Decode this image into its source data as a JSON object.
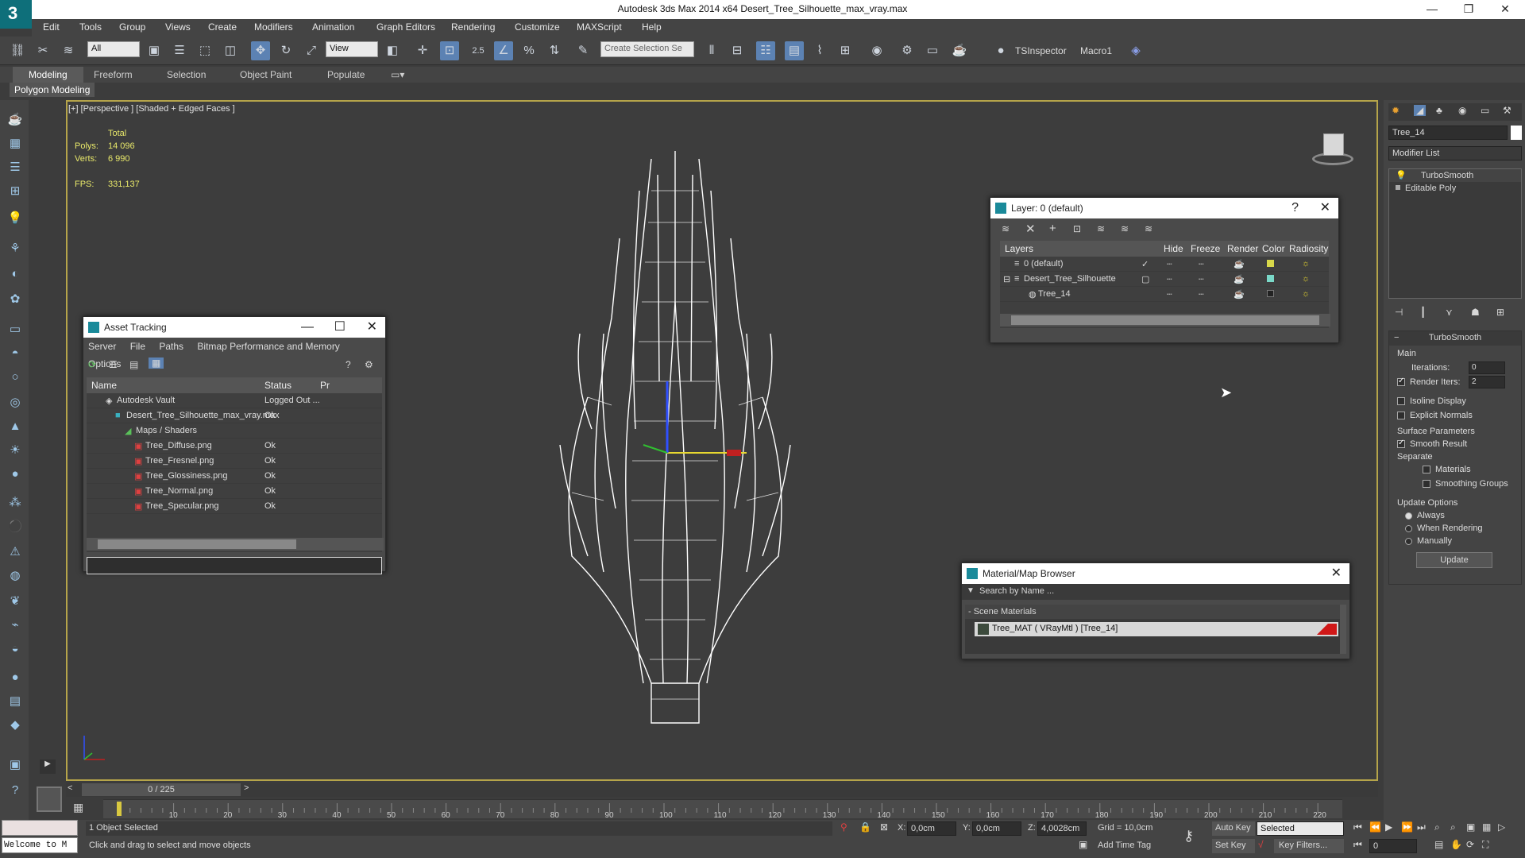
{
  "window": {
    "title": "Autodesk 3ds Max  2014 x64     Desert_Tree_Silhouette_max_vray.max"
  },
  "menu": [
    "Edit",
    "Tools",
    "Group",
    "Views",
    "Create",
    "Modifiers",
    "Animation",
    "Graph Editors",
    "Rendering",
    "Customize",
    "MAXScript",
    "Help"
  ],
  "toolbar": {
    "selection_filter": "All",
    "ref_coord": "View",
    "snap_value": "2.5",
    "named_selection_placeholder": "Create Selection Se",
    "tsinspector": "TSInspector",
    "macro1": "Macro1"
  },
  "ribbon": {
    "tabs": [
      "Modeling",
      "Freeform",
      "Selection",
      "Object Paint",
      "Populate"
    ],
    "active": "Modeling",
    "sub": "Polygon Modeling"
  },
  "viewport": {
    "label": "[+] [Perspective ] [Shaded + Edged Faces ]",
    "stats": {
      "total": "Total",
      "polys_label": "Polys:",
      "polys": "14 096",
      "verts_label": "Verts:",
      "verts": "6 990",
      "fps_label": "FPS:",
      "fps": "331,137"
    }
  },
  "asset_tracking": {
    "title": "Asset Tracking",
    "menu": [
      "Server",
      "File",
      "Paths",
      "Bitmap Performance and Memory",
      "Options"
    ],
    "columns": [
      "Name",
      "Status",
      "Pr"
    ],
    "rows": [
      {
        "name": "Autodesk Vault",
        "status": "Logged Out ..."
      },
      {
        "name": "Desert_Tree_Silhouette_max_vray.max",
        "status": "Ok"
      },
      {
        "name": "Maps / Shaders",
        "status": ""
      },
      {
        "name": "Tree_Diffuse.png",
        "status": "Ok"
      },
      {
        "name": "Tree_Fresnel.png",
        "status": "Ok"
      },
      {
        "name": "Tree_Glossiness.png",
        "status": "Ok"
      },
      {
        "name": "Tree_Normal.png",
        "status": "Ok"
      },
      {
        "name": "Tree_Specular.png",
        "status": "Ok"
      }
    ]
  },
  "layer_dialog": {
    "title": "Layer: 0 (default)",
    "columns": [
      "Layers",
      "Hide",
      "Freeze",
      "Render",
      "Color",
      "Radiosity"
    ],
    "rows": [
      {
        "name": "0 (default)",
        "color": "#d8d84a"
      },
      {
        "name": "Desert_Tree_Silhouette",
        "color": "#7ad8c8"
      },
      {
        "name": "Tree_14",
        "color": "#222222"
      }
    ]
  },
  "material_browser": {
    "title": "Material/Map Browser",
    "search_placeholder": "Search by Name ...",
    "group": "- Scene Materials",
    "item": "Tree_MAT  ( VRayMtl )  [Tree_14]"
  },
  "command_panel": {
    "object_name": "Tree_14",
    "modifier_list": "Modifier List",
    "stack": [
      "TurboSmooth",
      "Editable Poly"
    ],
    "rollout": "TurboSmooth",
    "main_label": "Main",
    "iterations_label": "Iterations:",
    "iterations": "0",
    "render_iters_label": "Render Iters:",
    "render_iters": "2",
    "isoline": "Isoline Display",
    "explicit": "Explicit Normals",
    "surface": "Surface Parameters",
    "smooth_result": "Smooth Result",
    "separate": "Separate",
    "materials": "Materials",
    "smoothing_groups": "Smoothing Groups",
    "update_options": "Update Options",
    "always": "Always",
    "when_rendering": "When Rendering",
    "manually": "Manually",
    "update_button": "Update"
  },
  "timeline": {
    "frame": "0 / 225",
    "ticks": [
      "10",
      "20",
      "30",
      "40",
      "50",
      "60",
      "70",
      "80",
      "90",
      "100",
      "110",
      "120",
      "130",
      "140",
      "150",
      "160",
      "170",
      "180",
      "190",
      "200",
      "210",
      "220"
    ]
  },
  "status": {
    "welcome": "Welcome to M",
    "selected": "1 Object Selected",
    "prompt": "Click and drag to select and move objects",
    "x_label": "X:",
    "x": "0,0cm",
    "y_label": "Y:",
    "y": "0,0cm",
    "z_label": "Z:",
    "z": "4,0028cm",
    "grid": "Grid = 10,0cm",
    "add_time_tag": "Add Time Tag",
    "auto_key": "Auto Key",
    "set_key": "Set Key",
    "selected_dd": "Selected",
    "key_filters": "Key Filters...",
    "frame_field": "0"
  }
}
